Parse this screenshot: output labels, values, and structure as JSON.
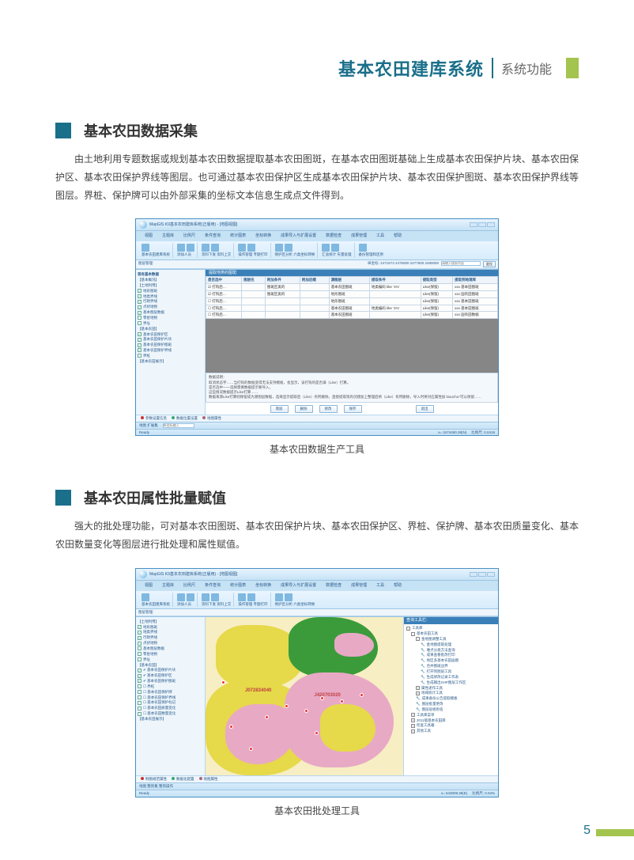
{
  "header": {
    "title": "基本农田建库系统",
    "subtitle": "系统功能"
  },
  "section1": {
    "title": "基本农田数据采集",
    "body": "由土地利用专题数据或规划基本农田数据提取基本农田图斑，在基本农田图斑基础上生成基本农田保护片块、基本农田保护区、基本农田保护界线等图层。也可通过基本农田保护区生成基本农田保护片块、基本农田保护图斑、基本农田保护界线等图层。界桩、保护牌可以由外部采集的坐标文本信息生成点文件得到。",
    "caption": "基本农田数据生产工具"
  },
  "section2": {
    "title": "基本农田属性批量赋值",
    "body": "强大的批处理功能，可对基本农田图斑、基本农田保护片块、基本农田保护区、界桩、保护牌、基本农田质量变化、基本农田数量变化等图层进行批处理和属性赋值。",
    "caption": "基本农田批处理工具"
  },
  "app": {
    "window_title": "MapGIS K9基本农田建库系统(正版用) - [地图视图]",
    "menu_tabs": [
      "视图",
      "主题库",
      "比例尺",
      "条件查询",
      "统计图表",
      "坐标转换",
      "成果导入与扩展设置",
      "数据检查",
      "成果管理",
      "工具",
      "帮助"
    ],
    "ribbon_groups": [
      {
        "label": "基本农田建库系统",
        "icons": 2
      },
      {
        "label": "添加人员",
        "icons": 2
      },
      {
        "label": "资料下发 资料上交",
        "icons": 2
      },
      {
        "label": "操作管理 专题打印",
        "icons": 2
      },
      {
        "label": "保护区分析 六类坐标转换",
        "icons": 2
      },
      {
        "label": "汇总统计 矢量处理",
        "icons": 2
      },
      {
        "label": "备份管理和还原",
        "icons": 1
      }
    ],
    "tree_header": "图层管理:",
    "tree_title": "现有基本数据",
    "tree_items": [
      "【基本概况】",
      "【土地利用】",
      "  地形图斑",
      "  地类界线",
      "  行政界线",
      "  点状地物",
      "  基本图层数据",
      "  零星地物",
      "  界址",
      "【基本农田】",
      "  基本农田保护区",
      "  基本农田保护片块",
      "  基本农田保护图斑",
      "  基本农田保护界线",
      "  界桩",
      "【基本农田展示】"
    ],
    "coord_hint": "纵坐标: 2471573    2475000    2477500    2480000",
    "panel_title": "提取地类的图斑:",
    "grid_headers": [
      "是否选中",
      "图层名",
      "附加条件",
      "附加后缀",
      "源图层",
      "提取条件",
      "提取类型",
      "提取到地理库"
    ],
    "grid_rows": [
      [
        "☑ 打钩后…",
        "",
        "图斑区类的",
        "",
        "基本农田图斑",
        "地类编码 like '1%'",
        "Like(保留)",
        "xxx 基本田图斑"
      ],
      [
        "☑ 打钩后…",
        "",
        "图斑区类的",
        "",
        "地形图斑",
        "",
        "Like(保留)",
        "xxx 国有田图斑"
      ],
      [
        "☐ 打钩后…",
        "",
        "",
        "",
        "地形图斑",
        "",
        "Like(保留)",
        "xxx 基本田图斑"
      ],
      [
        "☐ 打钩后…",
        "",
        "",
        "",
        "基本农田图斑",
        "地类编码 like '1%'",
        "Like(保留)",
        "xxx 基本田图斑"
      ],
      [
        "☐ 打钩后…",
        "",
        "",
        "",
        "基本农田图斑",
        "",
        "Like(保留)",
        "xxx 国有田数据"
      ]
    ],
    "note_lines": [
      "数据说明：",
      "取消状态字……当打钩的数据变得无法支持模板，会显示，该打钩的是否满（Like）打算。",
      "是否选中——选择需要数据提示要导入，",
      "这些情况数据提示Like打算……",
      "数据来源Like打算则保留成为源图层数据，选择显示提取后（Like）有所删除，直接提取现有创建加上整理后将（Like）有所删除，导入时将对应属性加 biaozhu*可以保留……"
    ],
    "buttons": [
      "增加",
      "删除",
      "修改",
      "保存",
      "退出"
    ],
    "bottom_tabs": [
      {
        "label": "参数设置信息",
        "color": "#c33"
      },
      {
        "label": "数据位置设置",
        "color": "#3a7"
      },
      {
        "label": "地图属性",
        "color": "#a67"
      }
    ],
    "status_left": "Ready",
    "status_views": [
      "地图   扩展集",
      ""
    ],
    "status_coord": "x= 3474460.38(N)",
    "status_scale": "比例尺: 0.0419",
    "search_hint": "请输入搜索内容",
    "go_btn": "定位",
    "bottom_input_hint": "纵坐标输入"
  },
  "app2": {
    "map_labels": [
      "J072834040",
      "J420703020"
    ],
    "rightpane_title": "查询工具栏:",
    "tool_root": "工具库",
    "tool_groups": [
      "基本农田工具",
      "金地图调整工具",
      "金地图提取处理",
      "难点分类方法查询",
      "成果查看批改打印",
      "地区多基本农田画图",
      "合并图斑边界",
      "打开到图层工具",
      "生成修改记录工作表",
      "生成输出SHP图层工作区",
      "属性递作工具",
      "地域统计工具",
      "成果备份公告提取模板",
      "图层批量更改",
      "图层层组别名",
      "工具库菜单",
      "2011版基本农田库",
      "检查工具箱",
      "其他工具"
    ],
    "layers_section": "【基本农田】",
    "layers": [
      "✔ 基本农田保护片块",
      "✔ 基本农田保护区",
      "✔ 基本农田保护图斑",
      "☐ 界桩",
      "☐ 基本农田保护牌",
      "☐ 基本农田保护界线",
      "☐ 基本农田保护标记",
      "☐ 基本农田质量变化",
      "☐ 基本农田数量变化",
      "【基本农田展示】"
    ],
    "bottom_tabs": [
      {
        "label": "制图规范属性",
        "color": "#c33"
      },
      {
        "label": "数据化配置",
        "color": "#3a7"
      },
      {
        "label": "地图属性",
        "color": "#a67"
      }
    ],
    "status_views": "地图   整饰集   整饰操作",
    "status_coord": "x= 543009.36(E)",
    "status_scale": "比例尺: 0.04%"
  },
  "page_number": "5"
}
